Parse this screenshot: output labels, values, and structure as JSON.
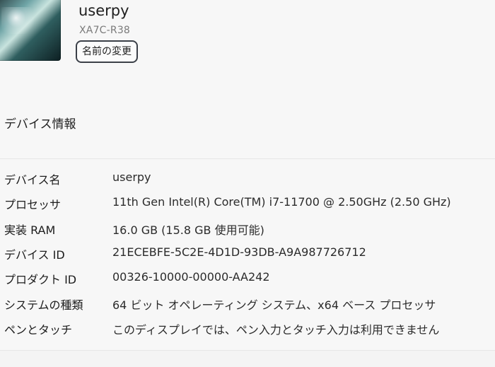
{
  "device": {
    "name": "userpy",
    "model": "XA7C-R38",
    "rename_button": "名前の変更"
  },
  "section": {
    "title": "デバイス情報"
  },
  "specs": [
    {
      "label": "デバイス名",
      "value": "userpy"
    },
    {
      "label": "プロセッサ",
      "value": "11th Gen Intel(R) Core(TM) i7-11700 @ 2.50GHz (2.50 GHz)"
    },
    {
      "label": "実装 RAM",
      "value": "16.0 GB (15.8 GB 使用可能)"
    },
    {
      "label": "デバイス ID",
      "value": "21ECEBFE-5C2E-4D1D-93DB-A9A987726712"
    },
    {
      "label": "プロダクト ID",
      "value": "00326-10000-00000-AA242"
    },
    {
      "label": "システムの種類",
      "value": "64 ビット オペレーティング システム、x64 ベース プロセッサ"
    },
    {
      "label": "ペンとタッチ",
      "value": "このディスプレイでは、ペン入力とタッチ入力は利用できません"
    }
  ]
}
